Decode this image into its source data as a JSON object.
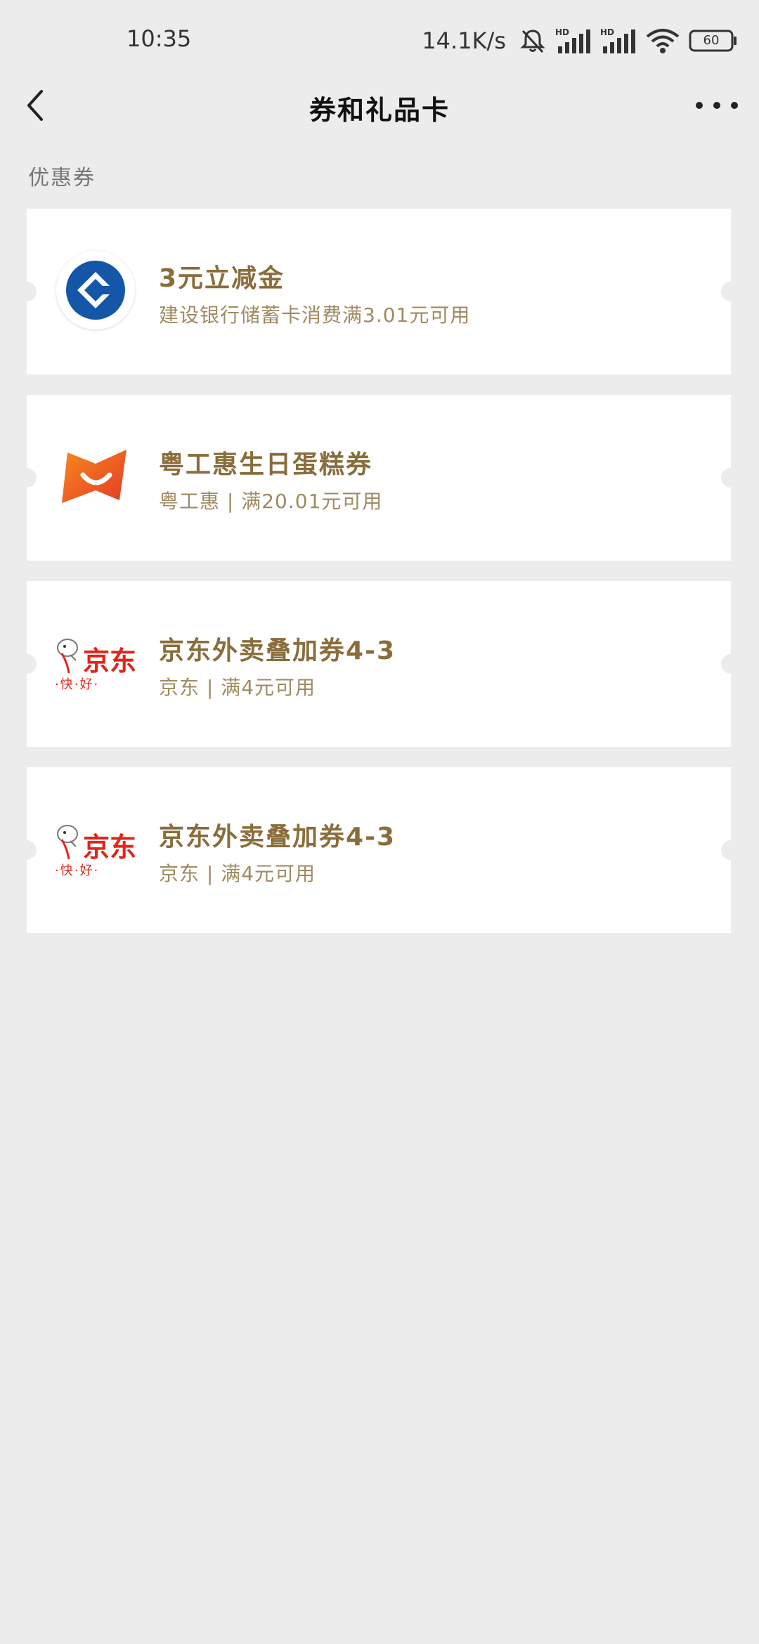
{
  "status_bar": {
    "time": "10:35",
    "net_speed": "14.1K/s",
    "battery": "60",
    "icons": [
      "bell-muted-icon",
      "hd-signal-icon",
      "hd-signal-icon",
      "wifi-icon",
      "battery-icon"
    ]
  },
  "header": {
    "title": "券和礼品卡",
    "back_icon": "chevron-left-icon",
    "more_icon": "more-dots-icon"
  },
  "section": {
    "label": "优惠券"
  },
  "coupons": [
    {
      "logo": "ccb-logo",
      "title": "3元立减金",
      "subtitle": "建设银行储蓄卡消费满3.01元可用"
    },
    {
      "logo": "yuegonghui-logo",
      "title": "粤工惠生日蛋糕券",
      "subtitle": "粤工惠 | 满20.01元可用"
    },
    {
      "logo": "jd-logo",
      "logo_text": "京东",
      "logo_slogan": "·快·好·",
      "title": "京东外卖叠加券4-3",
      "subtitle": "京东 | 满4元可用"
    },
    {
      "logo": "jd-logo",
      "logo_text": "京东",
      "logo_slogan": "·快·好·",
      "title": "京东外卖叠加券4-3",
      "subtitle": "京东 | 满4元可用"
    }
  ],
  "colors": {
    "background": "#ececec",
    "coupon_title": "#8a6d3b",
    "coupon_subtitle": "#a08a60",
    "ccb_blue": "#1456a7",
    "jd_red": "#e1251b"
  }
}
